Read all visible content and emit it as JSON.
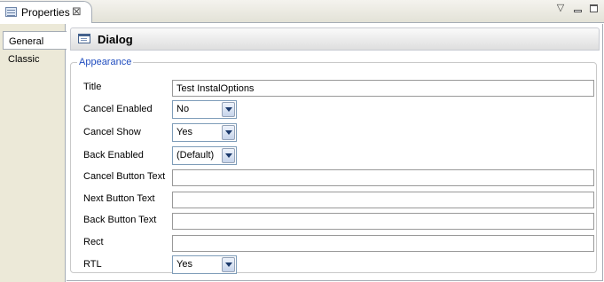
{
  "view": {
    "title": "Properties",
    "close_glyph": "⊠",
    "menu_glyph": "▽",
    "icon": "properties-icon"
  },
  "side_tabs": [
    {
      "label": "General",
      "active": true
    },
    {
      "label": "Classic",
      "active": false
    }
  ],
  "header": {
    "title": "Dialog",
    "icon": "dialog-icon"
  },
  "group": {
    "legend": "Appearance"
  },
  "fields": {
    "title": {
      "label": "Title",
      "value": "Test InstalOptions"
    },
    "cancel_enabled": {
      "label": "Cancel Enabled",
      "value": "No"
    },
    "cancel_show": {
      "label": "Cancel Show",
      "value": "Yes"
    },
    "back_enabled": {
      "label": "Back Enabled",
      "value": "(Default)"
    },
    "cancel_button_text": {
      "label": "Cancel Button Text",
      "value": ""
    },
    "next_button_text": {
      "label": "Next Button Text",
      "value": ""
    },
    "back_button_text": {
      "label": "Back Button Text",
      "value": ""
    },
    "rect": {
      "label": "Rect",
      "value": ""
    },
    "rtl": {
      "label": "RTL",
      "value": "Yes"
    }
  },
  "colors": {
    "legend": "#1f4cbf",
    "chrome": "#ece9d8",
    "border": "#a5acb5"
  }
}
